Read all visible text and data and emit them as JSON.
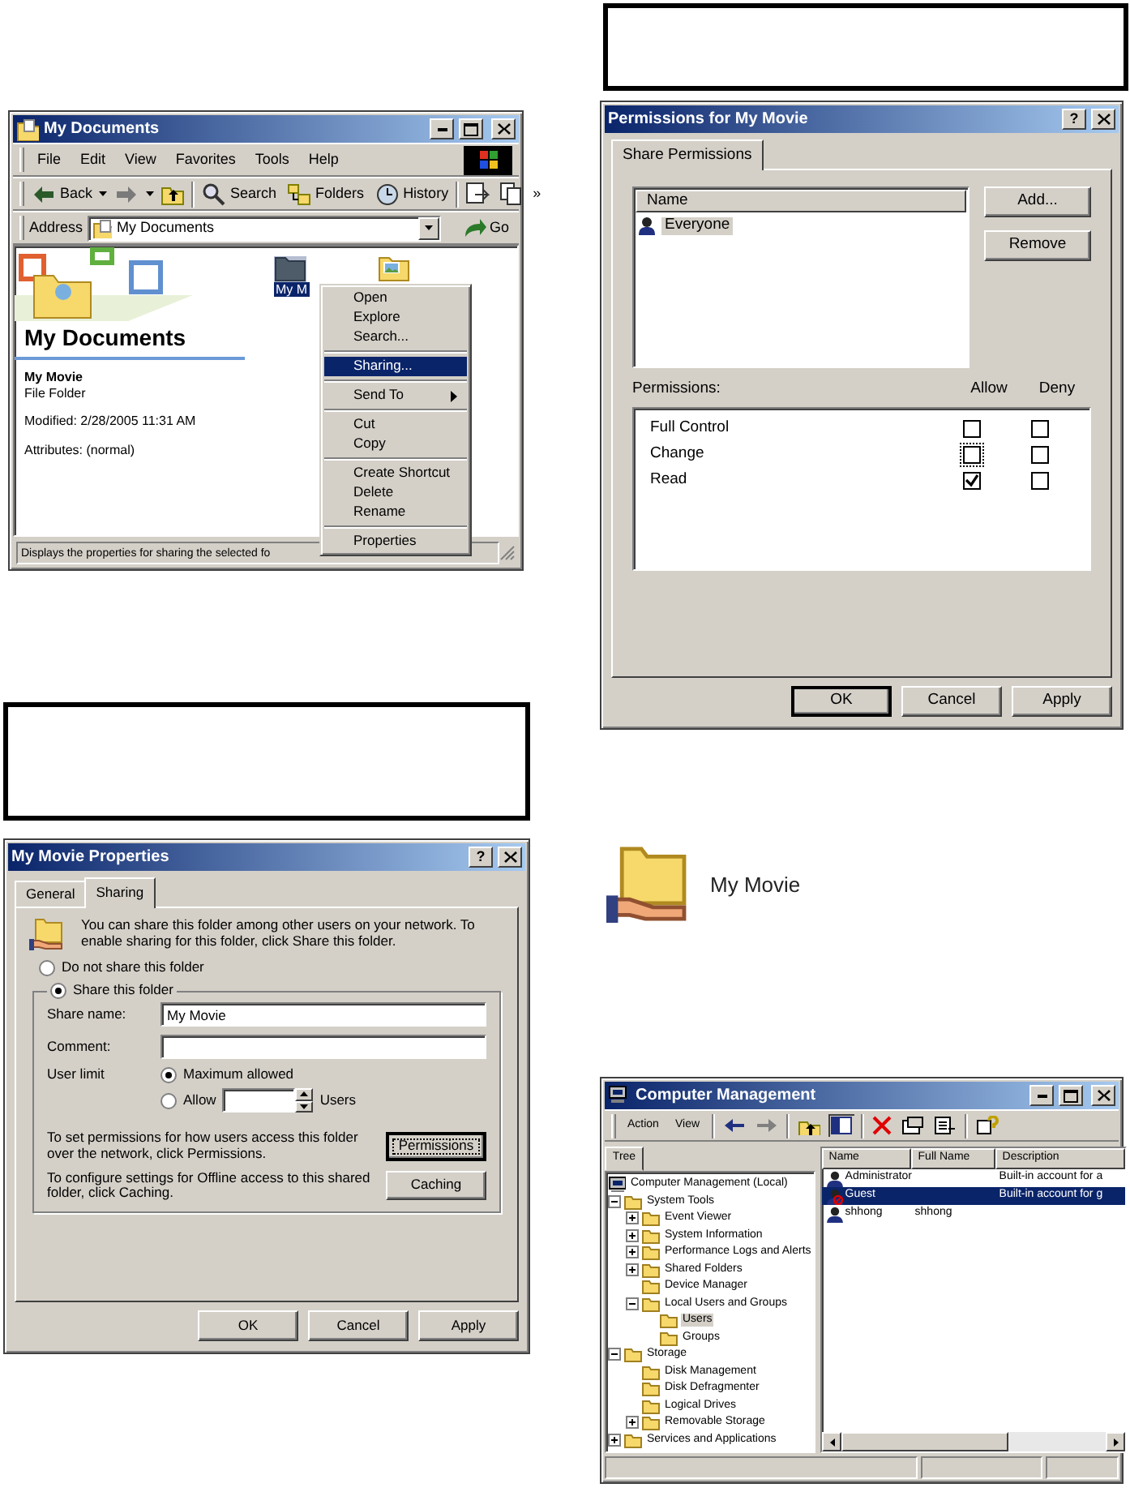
{
  "explorer": {
    "title": "My Documents",
    "menu": [
      "File",
      "Edit",
      "View",
      "Favorites",
      "Tools",
      "Help"
    ],
    "back": "Back",
    "tools": [
      "Search",
      "Folders",
      "History"
    ],
    "more": "»",
    "address_label": "Address",
    "address": "My Documents",
    "go": "Go",
    "heading": "My Documents",
    "item_name": "My Movie",
    "item_type": "File Folder",
    "modified": "Modified: 2/28/2005 11:31 AM",
    "attributes": "Attributes: (normal)",
    "files": [
      {
        "kind": "folder",
        "label": "My M",
        "selected": true
      },
      {
        "kind": "picture_folder",
        "selected": false
      }
    ],
    "context_menu": [
      {
        "kind": "item",
        "label": "Open",
        "selected": false
      },
      {
        "kind": "item",
        "label": "Explore",
        "selected": false
      },
      {
        "kind": "item",
        "label": "Search...",
        "selected": false
      },
      {
        "kind": "separator"
      },
      {
        "kind": "item",
        "label": "Sharing...",
        "selected": true
      },
      {
        "kind": "separator"
      },
      {
        "kind": "submenu",
        "label": "Send To",
        "selected": false
      },
      {
        "kind": "separator"
      },
      {
        "kind": "item",
        "label": "Cut",
        "selected": false
      },
      {
        "kind": "item",
        "label": "Copy",
        "selected": false
      },
      {
        "kind": "separator"
      },
      {
        "kind": "item",
        "label": "Create Shortcut",
        "selected": false
      },
      {
        "kind": "item",
        "label": "Delete",
        "selected": false
      },
      {
        "kind": "item",
        "label": "Rename",
        "selected": false
      },
      {
        "kind": "separator"
      },
      {
        "kind": "item",
        "label": "Properties",
        "selected": false
      }
    ],
    "status": "Displays the properties for sharing the selected fo"
  },
  "permissions": {
    "title": "Permissions for My Movie",
    "help": "?",
    "tabs": [
      {
        "label": "Share Permissions",
        "selected": true
      }
    ],
    "name_header": "Name",
    "users": [
      {
        "name": "Everyone",
        "selected": true
      }
    ],
    "side_buttons": [
      "Add...",
      "Remove"
    ],
    "permissions_label": "Permissions:",
    "columns": [
      "Allow",
      "Deny"
    ],
    "rows": [
      {
        "name": "Full Control",
        "allow": false,
        "deny": false,
        "focused": false
      },
      {
        "name": "Change",
        "allow": false,
        "deny": false,
        "focused": true
      },
      {
        "name": "Read",
        "allow": true,
        "deny": false,
        "focused": false
      }
    ],
    "buttons": [
      {
        "label": "OK",
        "default": true
      },
      {
        "label": "Cancel",
        "default": false
      },
      {
        "label": "Apply",
        "default": false
      }
    ]
  },
  "properties": {
    "title": "My Movie Properties",
    "help": "?",
    "tabs": [
      {
        "label": "General",
        "selected": false
      },
      {
        "label": "Sharing",
        "selected": true
      }
    ],
    "intro": "You can share this folder among other users on your network.  To enable sharing for this folder, click Share this folder.",
    "radios": [
      {
        "label": "Do not share this folder",
        "selected": false
      },
      {
        "label": "Share this folder",
        "selected": true
      }
    ],
    "share_name_label": "Share name:",
    "share_name": "My Movie",
    "comment_label": "Comment:",
    "user_limit_label": "User limit",
    "limit_options": [
      {
        "label": "Maximum allowed",
        "selected": true
      },
      {
        "label": "Allow",
        "selected": false
      }
    ],
    "users_unit": "Users",
    "permissions_text": "To set permissions for how users access this folder over the network, click Permissions.",
    "permissions_button": {
      "label": "Permissions",
      "focused": true
    },
    "caching_text": "To configure settings for Offline access to this shared folder, click Caching.",
    "caching_button": {
      "label": "Caching",
      "focused": false
    },
    "buttons": [
      {
        "label": "OK",
        "default": false
      },
      {
        "label": "Cancel",
        "default": false
      },
      {
        "label": "Apply",
        "default": false
      }
    ]
  },
  "shared_folder": {
    "label": "My Movie"
  },
  "computer_management": {
    "title": "Computer Management",
    "menus": [
      "Action",
      "View"
    ],
    "tree_tab": "Tree",
    "tree": [
      {
        "label": "Computer Management (Local)",
        "selected": false,
        "children": [
          {
            "label": "System Tools",
            "expanded": true,
            "selected": false,
            "children": [
              {
                "label": "Event Viewer",
                "expanded": false,
                "selected": false
              },
              {
                "label": "System Information",
                "expanded": false,
                "selected": false
              },
              {
                "label": "Performance Logs and Alerts",
                "expanded": false,
                "selected": false
              },
              {
                "label": "Shared Folders",
                "expanded": false,
                "selected": false
              },
              {
                "label": "Device Manager",
                "selected": false
              },
              {
                "label": "Local Users and Groups",
                "expanded": true,
                "selected": false,
                "children": [
                  {
                    "label": "Users",
                    "selected": true
                  },
                  {
                    "label": "Groups",
                    "selected": false
                  }
                ]
              }
            ]
          },
          {
            "label": "Storage",
            "expanded": true,
            "selected": false,
            "children": [
              {
                "label": "Disk Management",
                "selected": false
              },
              {
                "label": "Disk Defragmenter",
                "selected": false
              },
              {
                "label": "Logical Drives",
                "selected": false
              },
              {
                "label": "Removable Storage",
                "expanded": false,
                "selected": false
              }
            ]
          },
          {
            "label": "Services and Applications",
            "expanded": false,
            "selected": false
          }
        ]
      }
    ],
    "columns": [
      "Name",
      "Full Name",
      "Description"
    ],
    "users": [
      {
        "name": "Administrator",
        "description": "Built-in account for a",
        "selected": false,
        "disabled": false
      },
      {
        "name": "Guest",
        "description": "Built-in account for g",
        "selected": true,
        "disabled": true
      },
      {
        "name": "shhong",
        "full_name": "shhong",
        "selected": false,
        "disabled": false
      }
    ]
  }
}
